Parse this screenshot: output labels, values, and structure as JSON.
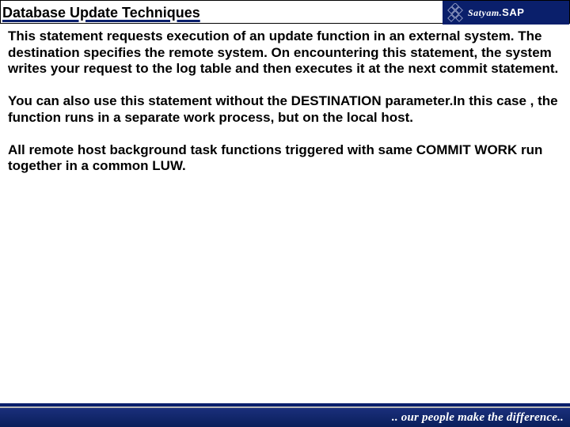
{
  "header": {
    "title": "Database Update Techniques",
    "brand1": "Satyam",
    "brand2": "SAP"
  },
  "body": {
    "p1": "This statement requests execution of an update function in an external system. The destination specifies the remote system. On encountering this statement, the system writes your request  to the log table and then executes it at the next commit statement.",
    "p2": "You can also use this statement without the DESTINATION parameter.In this case , the function runs in a separate work process, but on the local host.",
    "p3": "All remote host background task functions triggered with same COMMIT WORK run together in a common LUW."
  },
  "footer": {
    "tagline": ".. our people make the difference.."
  }
}
